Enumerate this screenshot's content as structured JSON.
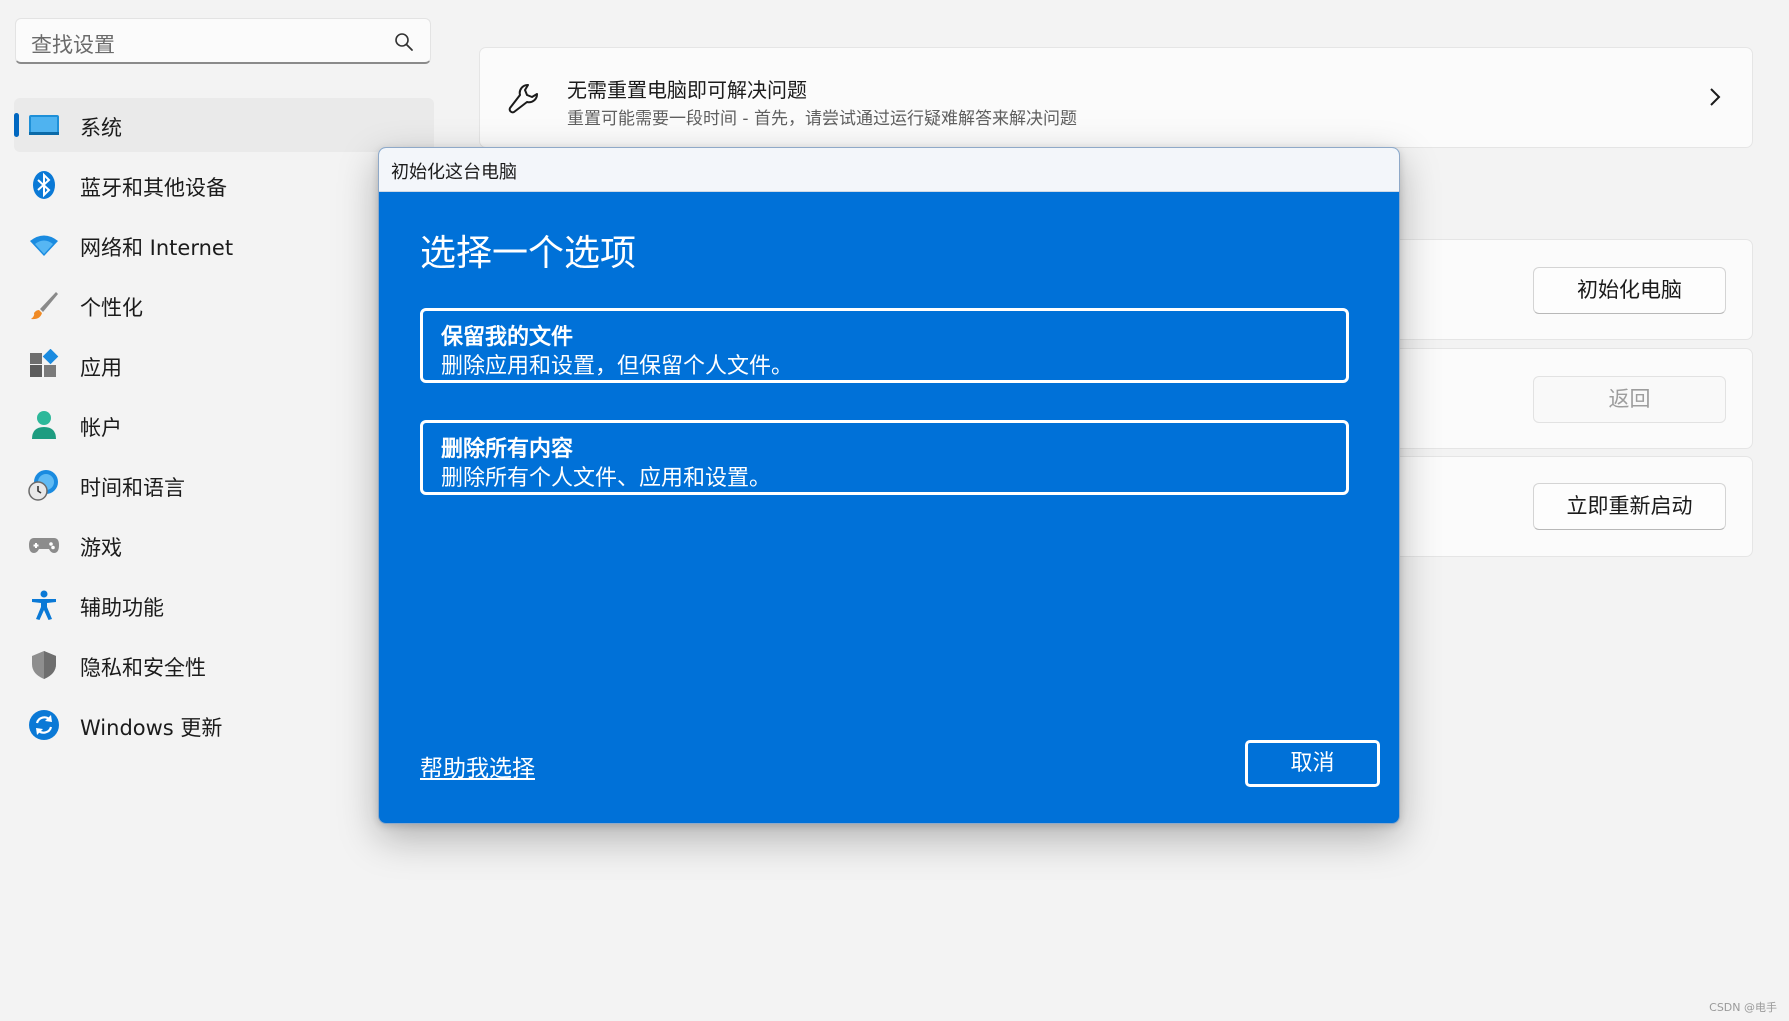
{
  "sidebar": {
    "search_placeholder": "查找设置",
    "items": [
      {
        "label": "系统",
        "icon": "monitor-icon",
        "active": true
      },
      {
        "label": "蓝牙和其他设备",
        "icon": "bluetooth-icon"
      },
      {
        "label": "网络和 Internet",
        "icon": "wifi-icon"
      },
      {
        "label": "个性化",
        "icon": "paintbrush-icon"
      },
      {
        "label": "应用",
        "icon": "apps-icon"
      },
      {
        "label": "帐户",
        "icon": "person-icon"
      },
      {
        "label": "时间和语言",
        "icon": "globe-clock-icon"
      },
      {
        "label": "游戏",
        "icon": "gamepad-icon"
      },
      {
        "label": "辅助功能",
        "icon": "accessibility-icon"
      },
      {
        "label": "隐私和安全性",
        "icon": "shield-icon"
      },
      {
        "label": "Windows 更新",
        "icon": "update-icon"
      }
    ]
  },
  "main": {
    "fix_card": {
      "title": "无需重置电脑即可解决问题",
      "subtitle": "重置可能需要一段时间 - 首先，请尝试通过运行疑难解答来解决问题"
    },
    "buttons": {
      "reset": "初始化电脑",
      "go_back": "返回",
      "restart": "立即重新启动"
    }
  },
  "dialog": {
    "window_title": "初始化这台电脑",
    "heading": "选择一个选项",
    "options": [
      {
        "title": "保留我的文件",
        "description": "删除应用和设置，但保留个人文件。"
      },
      {
        "title": "删除所有内容",
        "description": "删除所有个人文件、应用和设置。"
      }
    ],
    "help_link": "帮助我选择",
    "cancel": "取消"
  },
  "watermark": "CSDN @电手",
  "colors": {
    "accent": "#0067c0",
    "dialog_blue": "#0071d8",
    "background": "#f3f3f3"
  }
}
